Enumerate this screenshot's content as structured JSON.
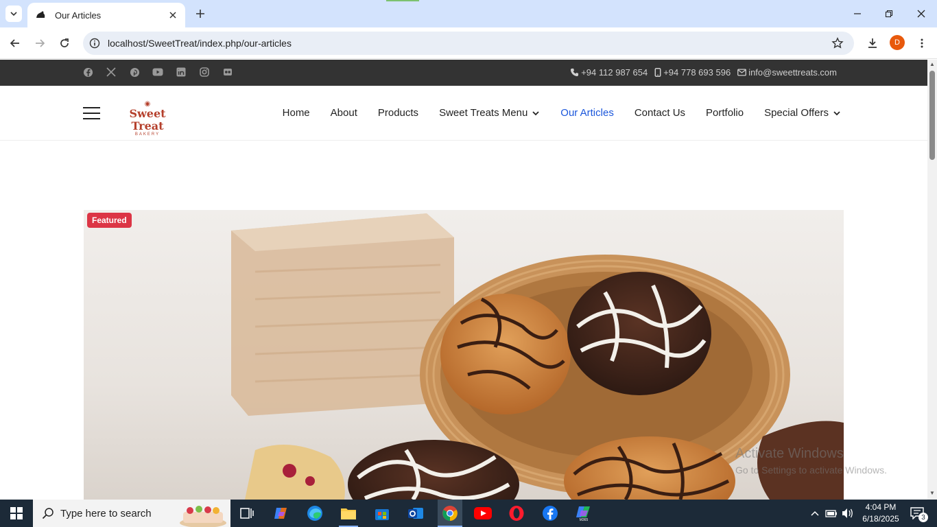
{
  "browser": {
    "tab_title": "Our Articles",
    "url": "localhost/SweetTreat/index.php/our-articles",
    "profile_initial": "D"
  },
  "topbar": {
    "social_icons": [
      "facebook-icon",
      "x-icon",
      "pinterest-icon",
      "youtube-icon",
      "linkedin-icon",
      "instagram-icon",
      "flickr-icon"
    ],
    "phone": "+94 112 987 654",
    "mobile": "+94 778 693 596",
    "email": "info@sweettreats.com"
  },
  "logo": {
    "name": "Sweet Treat",
    "sub": "BAKERY"
  },
  "nav": {
    "items": [
      {
        "label": "Home",
        "active": false,
        "dropdown": false
      },
      {
        "label": "About",
        "active": false,
        "dropdown": false
      },
      {
        "label": "Products",
        "active": false,
        "dropdown": false
      },
      {
        "label": "Sweet Treats Menu",
        "active": false,
        "dropdown": true
      },
      {
        "label": "Our Articles",
        "active": true,
        "dropdown": false
      },
      {
        "label": "Contact Us",
        "active": false,
        "dropdown": false
      },
      {
        "label": "Portfolio",
        "active": false,
        "dropdown": false
      },
      {
        "label": "Special Offers",
        "active": false,
        "dropdown": true
      }
    ],
    "active_color": "#1a56db"
  },
  "hero": {
    "badge": "Featured",
    "badge_color": "#dc3545"
  },
  "watermark": {
    "line1": "Activate Windows",
    "line2": "Go to Settings to activate Windows."
  },
  "taskbar": {
    "search_placeholder": "Type here to search",
    "time": "4:04 PM",
    "date": "6/18/2025",
    "notification_count": "3"
  }
}
